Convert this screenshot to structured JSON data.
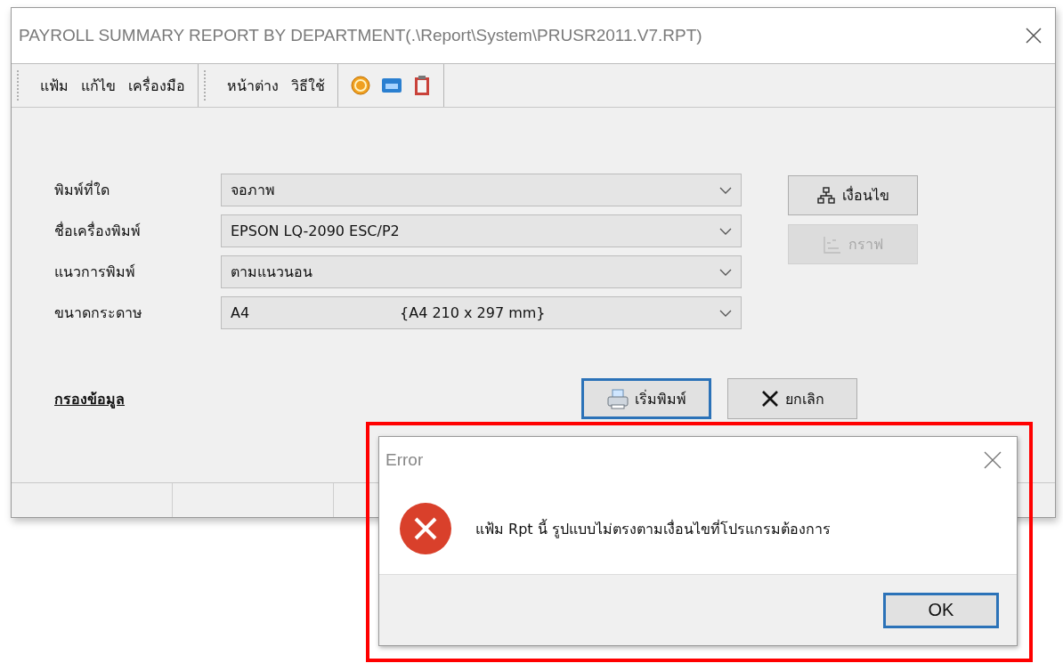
{
  "window": {
    "title": "PAYROLL SUMMARY REPORT BY DEPARTMENT(.\\Report\\System\\PRUSR2011.V7.RPT)"
  },
  "toolbar": {
    "menu_groups": [
      [
        "แฟ้ม",
        "แก้ไข",
        "เครื่องมือ"
      ],
      [
        "หน้าต่าง",
        "วิธีใช้"
      ]
    ]
  },
  "form": {
    "fields": [
      {
        "label": "พิมพ์ที่ใด",
        "value": "จอภาพ"
      },
      {
        "label": "ชื่อเครื่องพิมพ์",
        "value": "EPSON LQ-2090 ESC/P2"
      },
      {
        "label": "แนวการพิมพ์",
        "value": "ตามแนวนอน"
      },
      {
        "label": "ขนาดกระดาษ",
        "value": "A4",
        "detail": "{A4 210 x 297 mm}"
      }
    ],
    "side_buttons": [
      {
        "label": "เงื่อนไข",
        "kind": "condition",
        "disabled": false
      },
      {
        "label": "กราฟ",
        "kind": "graph",
        "disabled": true
      }
    ],
    "filter_link": "กรองข้อมูล",
    "action_buttons": [
      {
        "label": "เริ่มพิมพ์",
        "kind": "print",
        "default": true
      },
      {
        "label": "ยกเลิก",
        "kind": "cancel",
        "default": false
      }
    ]
  },
  "error_dialog": {
    "title": "Error",
    "message": "แฟ้ม Rpt นี้ รูปแบบไม่ตรงตามเงื่อนไขที่โปรแกรมต้องการ",
    "buttons": [
      {
        "label": "OK",
        "default": true
      }
    ]
  }
}
